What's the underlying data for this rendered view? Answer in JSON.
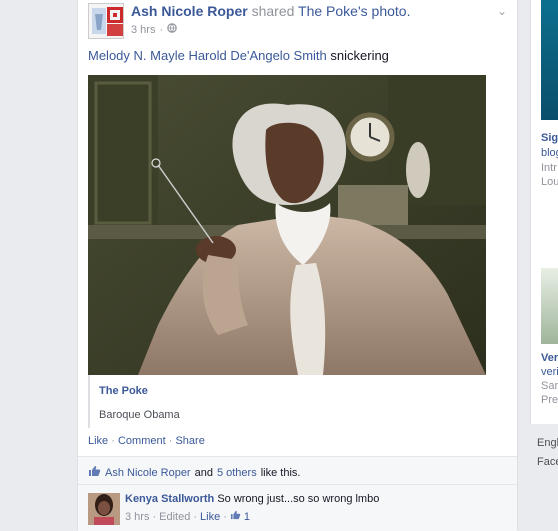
{
  "post": {
    "author": "Ash Nicole Roper",
    "shared_text": "shared",
    "source_link": "The Poke's photo.",
    "time": "3 hrs",
    "privacy_sep": "·",
    "tagged_1": "Melody N. Mayle",
    "tagged_2": "Harold De'Angelo Smith",
    "message": "snickering",
    "quote_title": "The Poke",
    "quote_caption": "Baroque Obama",
    "actions": {
      "like": "Like",
      "comment": "Comment",
      "share": "Share",
      "sep": "·"
    },
    "likes": {
      "name": "Ash Nicole Roper",
      "and_text": "and",
      "others": "5 others",
      "suffix": "like this."
    },
    "comment": {
      "author": "Kenya Stallworth",
      "text": "So wrong just...so so wrong lmbo",
      "time": "3 hrs",
      "edited": "Edited",
      "like": "Like",
      "sep": "·",
      "like_count": "1"
    }
  },
  "right_rail": {
    "item1_title": "Sig",
    "item1_line2": "blog",
    "item1_line3": "Intr",
    "item1_line4": "Lou",
    "item2_title": "Ver",
    "item2_line2": "veri",
    "item2_line3": "Sar",
    "item2_line4": "Pre",
    "footer1": "Engl",
    "footer2": "Face"
  },
  "colors": {
    "link": "#3b5998",
    "muted": "#90949c",
    "background": "#e9ebee"
  }
}
